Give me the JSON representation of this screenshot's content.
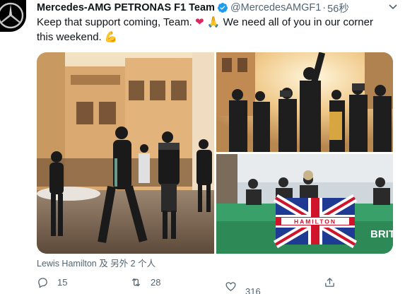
{
  "tweet": {
    "author": {
      "display_name": "Mercedes-AMG PETRONAS F1 Team",
      "handle": "@MercedesAMGF1",
      "separator": "·",
      "time": "56秒",
      "verified": true
    },
    "text_line1": "Keep that support coming, Team.",
    "text_line1b": "We need all of you in our corner",
    "text_line2": "this weekend.",
    "emojis": {
      "heart": "❤",
      "pray": "🙏",
      "muscle": "💪"
    },
    "photo_banner_text": "HAMILTON",
    "photo_sign_text": "BRIT",
    "tagged_people": "Lewis Hamilton 及 另外 2 个人",
    "actions": {
      "reply_count": "15",
      "retweet_count": "28",
      "like_count": "316"
    }
  },
  "colors": {
    "text": "#0f1419",
    "muted": "#536471",
    "verified": "#1d9bf0",
    "heart": "#e0245e"
  },
  "icons": [
    "mercedes-star-icon",
    "verified-badge-icon",
    "more-caret-icon",
    "reply-icon",
    "retweet-icon",
    "like-icon",
    "share-icon"
  ]
}
